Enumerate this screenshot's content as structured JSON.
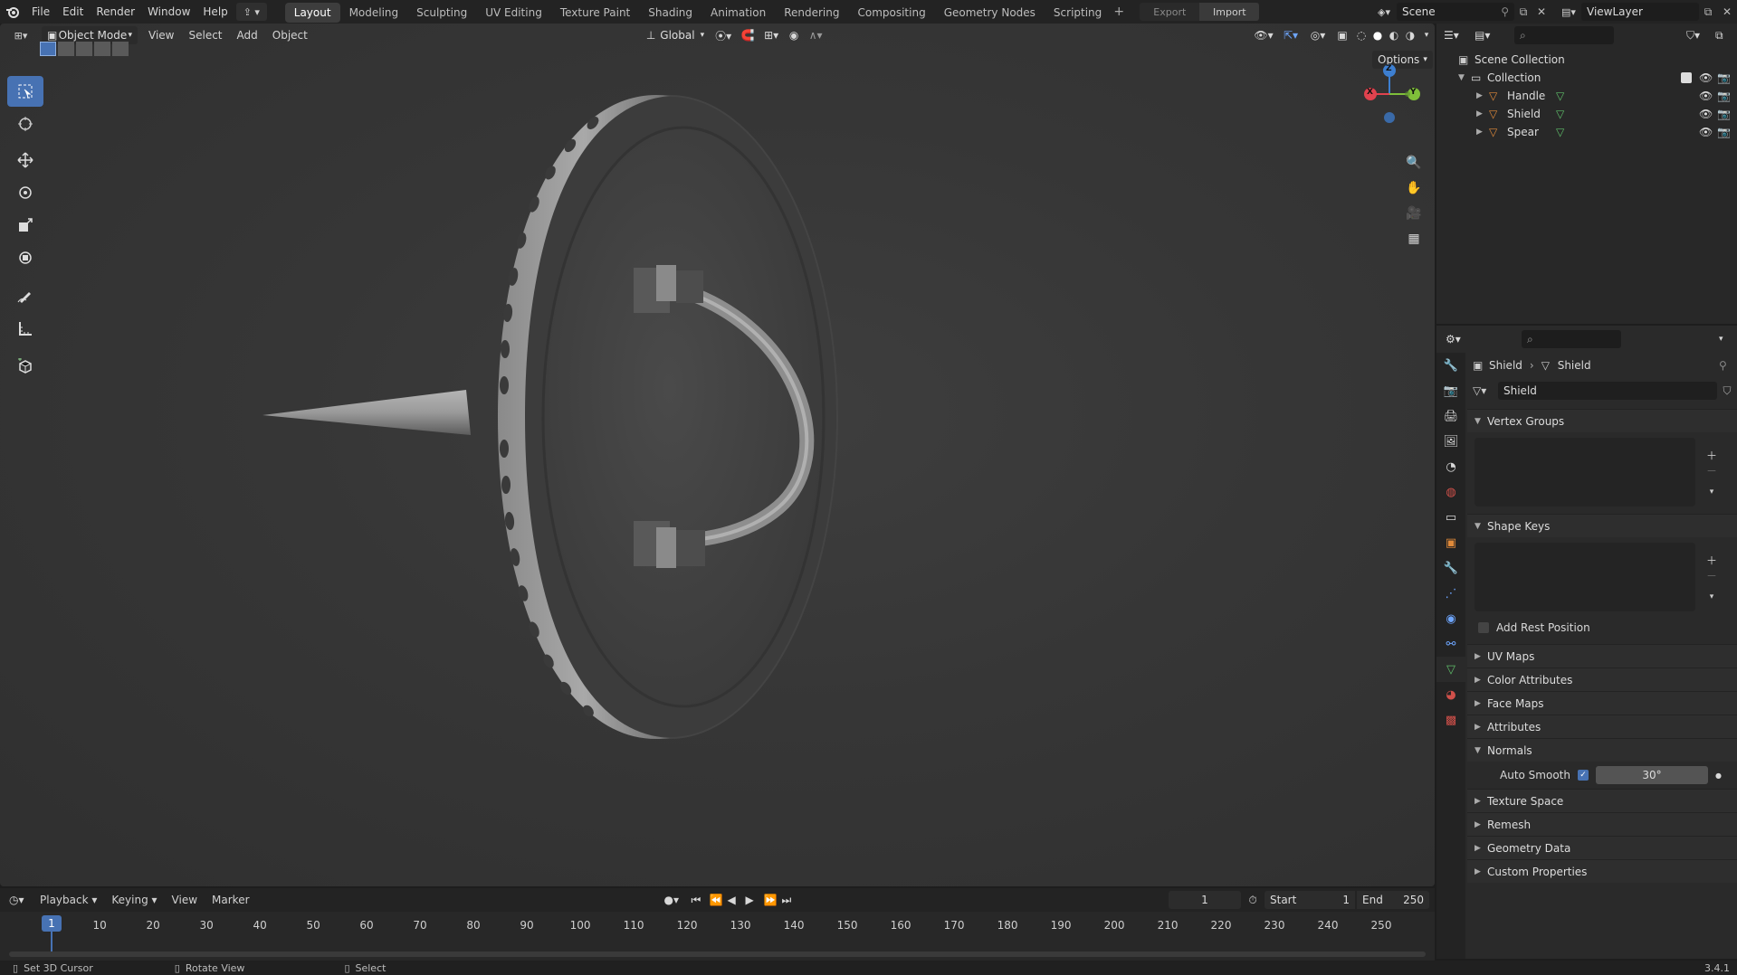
{
  "topbar": {
    "menus": [
      "File",
      "Edit",
      "Render",
      "Window",
      "Help"
    ],
    "workspaces": [
      "Layout",
      "Modeling",
      "Sculpting",
      "UV Editing",
      "Texture Paint",
      "Shading",
      "Animation",
      "Rendering",
      "Compositing",
      "Geometry Nodes",
      "Scripting"
    ],
    "active_workspace": "Layout",
    "export_label": "Export",
    "import_label": "Import",
    "scene_name": "Scene",
    "view_layer": "ViewLayer"
  },
  "viewport": {
    "mode": "Object Mode",
    "menus": [
      "View",
      "Select",
      "Add",
      "Object"
    ],
    "orientation": "Global",
    "options_label": "Options",
    "gizmo": {
      "x": "X",
      "y": "Y",
      "z": "Z"
    }
  },
  "outliner": {
    "scene_collection": "Scene Collection",
    "collection": "Collection",
    "objects": [
      "Handle",
      "Shield",
      "Spear"
    ]
  },
  "properties": {
    "breadcrumb_object": "Shield",
    "breadcrumb_data": "Shield",
    "mesh_name": "Shield",
    "panels": {
      "vertex_groups": "Vertex Groups",
      "shape_keys": "Shape Keys",
      "add_rest_position": "Add Rest Position",
      "uv_maps": "UV Maps",
      "color_attributes": "Color Attributes",
      "face_maps": "Face Maps",
      "attributes": "Attributes",
      "normals": "Normals",
      "auto_smooth": "Auto Smooth",
      "auto_smooth_angle": "30°",
      "texture_space": "Texture Space",
      "remesh": "Remesh",
      "geometry_data": "Geometry Data",
      "custom_properties": "Custom Properties"
    }
  },
  "timeline": {
    "menus": [
      "Playback",
      "Keying",
      "View",
      "Marker"
    ],
    "current_frame": "1",
    "start_label": "Start",
    "start": "1",
    "end_label": "End",
    "end": "250",
    "ticks": [
      "1",
      "10",
      "20",
      "30",
      "40",
      "50",
      "60",
      "70",
      "80",
      "90",
      "100",
      "110",
      "120",
      "130",
      "140",
      "150",
      "160",
      "170",
      "180",
      "190",
      "200",
      "210",
      "220",
      "230",
      "240",
      "250"
    ]
  },
  "status": {
    "left": "Set 3D Cursor",
    "middle": "Rotate View",
    "right": "Select",
    "version": "3.4.1"
  },
  "colors": {
    "accent": "#4772b3",
    "x_axis": "#e0424e",
    "y_axis": "#7fbf3a",
    "z_axis": "#3d7fd1",
    "mesh_icon": "#e08a3a",
    "data_icon": "#5fbf6a"
  }
}
